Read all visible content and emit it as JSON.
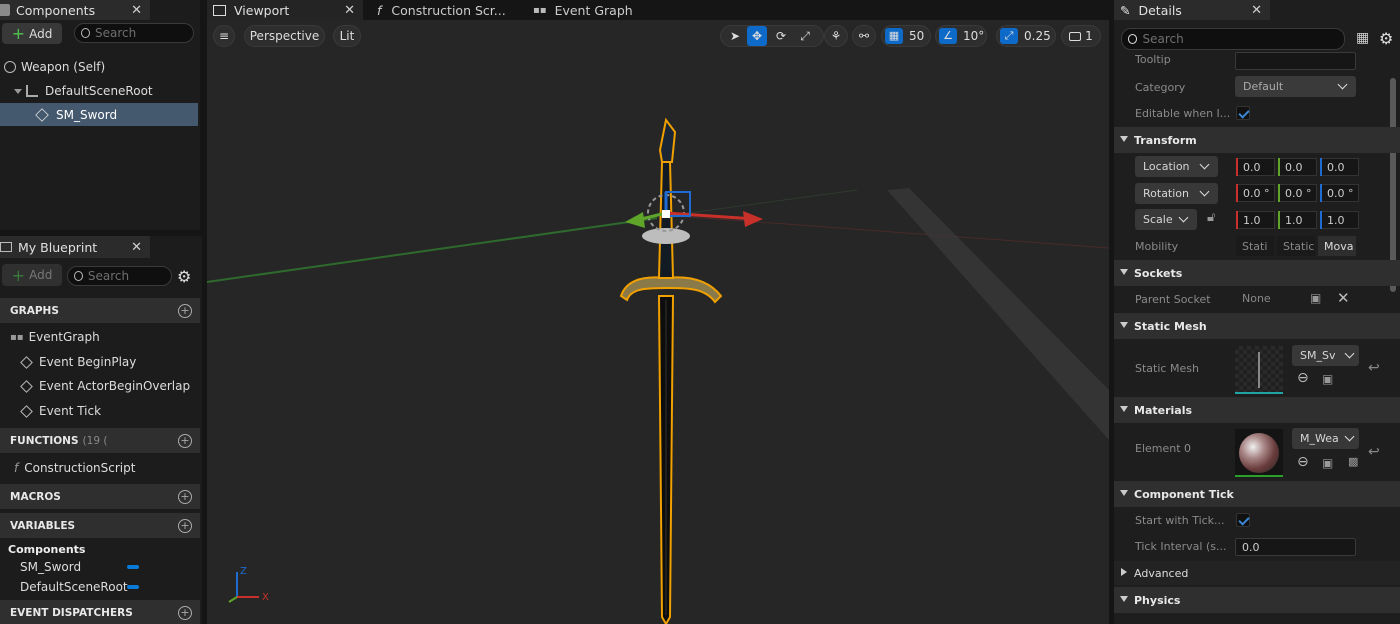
{
  "components_panel": {
    "tab_label": "Components",
    "add_label": "Add",
    "search_placeholder": "Search",
    "tree": [
      {
        "label": "Weapon (Self)"
      },
      {
        "label": "DefaultSceneRoot"
      },
      {
        "label": "SM_Sword"
      }
    ]
  },
  "blueprint_panel": {
    "tab_label": "My Blueprint",
    "add_label": "Add",
    "search_placeholder": "Search",
    "graphs_label": "GRAPHS",
    "event_graph_label": "EventGraph",
    "events": [
      "Event BeginPlay",
      "Event ActorBeginOverlap",
      "Event Tick"
    ],
    "functions_label": "FUNCTIONS",
    "functions_count": "(19 (",
    "construction_script_label": "ConstructionScript",
    "macros_label": "MACROS",
    "variables_label": "VARIABLES",
    "components_group_label": "Components",
    "variables": [
      "SM_Sword",
      "DefaultSceneRoot"
    ],
    "event_dispatchers_label": "EVENT DISPATCHERS",
    "variable_color": "#0a7ad8"
  },
  "viewport": {
    "tabs": [
      {
        "label": "Viewport"
      },
      {
        "label": "Construction Scr..."
      },
      {
        "label": "Event Graph"
      }
    ],
    "perspective_label": "Perspective",
    "lit_label": "Lit",
    "grid_snap": "50",
    "rotation_snap": "10°",
    "scale_snap": "0.25",
    "camera_speed": "1",
    "axis_x": "X",
    "axis_z": "Z",
    "accent_color": "#0e6ac9",
    "selection_color": "#f0a000"
  },
  "details": {
    "tab_label": "Details",
    "search_placeholder": "Search",
    "tooltip_label": "Tooltip",
    "category_label": "Category",
    "category_value": "Default",
    "editable_label": "Editable when I...",
    "transform_label": "Transform",
    "location_label": "Location",
    "location": [
      "0.0",
      "0.0",
      "0.0"
    ],
    "rotation_label": "Rotation",
    "rotation": [
      "0.0 °",
      "0.0 °",
      "0.0 °"
    ],
    "scale_label": "Scale",
    "scale": [
      "1.0",
      "1.0",
      "1.0"
    ],
    "mobility_label": "Mobility",
    "mobility_options": [
      "Stati",
      "Static",
      "Mova"
    ],
    "sockets_label": "Sockets",
    "parent_socket_label": "Parent Socket",
    "parent_socket_value": "None",
    "static_mesh_section_label": "Static Mesh",
    "static_mesh_label": "Static Mesh",
    "static_mesh_value": "SM_Sv",
    "materials_label": "Materials",
    "element0_label": "Element 0",
    "element0_value": "M_Wea",
    "component_tick_label": "Component Tick",
    "start_with_tick_label": "Start with Tick...",
    "tick_interval_label": "Tick Interval (s...",
    "tick_interval_value": "0.0",
    "advanced_label": "Advanced",
    "physics_label": "Physics",
    "x_color": "#c8312a",
    "y_color": "#5fa52a",
    "z_color": "#1e6bd1"
  }
}
